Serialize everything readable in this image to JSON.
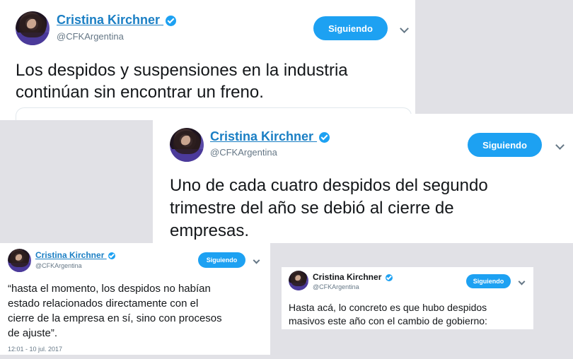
{
  "tweets": [
    {
      "author": "Cristina Kirchner",
      "handle": "@CFKArgentina",
      "follow_label": "Siguiendo",
      "text_lines": [
        "Los despidos y suspensiones en la industria",
        "continúan sin encontrar un freno."
      ]
    },
    {
      "author": "Cristina Kirchner",
      "handle": "@CFKArgentina",
      "follow_label": "Siguiendo",
      "text_lines": [
        "Uno de cada cuatro despidos del segundo",
        "trimestre del año se debió al cierre de",
        "empresas."
      ]
    },
    {
      "author": "Cristina Kirchner",
      "handle": "@CFKArgentina",
      "follow_label": "Siguiendo",
      "text_lines": [
        "“hasta el momento, los despidos no habían",
        "estado relacionados directamente con el",
        "cierre de la empresa en sí, sino con procesos",
        "de ajuste”."
      ],
      "timestamp": "12:01 - 10 jul. 2017"
    },
    {
      "author": "Cristina Kirchner",
      "handle": "@CFKArgentina",
      "follow_label": "Siguiendo",
      "text_lines": [
        "Hasta acá, lo concreto es que hubo despidos",
        "masivos este año con el cambio de gobierno:"
      ]
    }
  ],
  "colors": {
    "accent": "#1da1f2",
    "name_link": "#1b7fc4",
    "muted": "#657786",
    "background": "#e1e1e6"
  }
}
